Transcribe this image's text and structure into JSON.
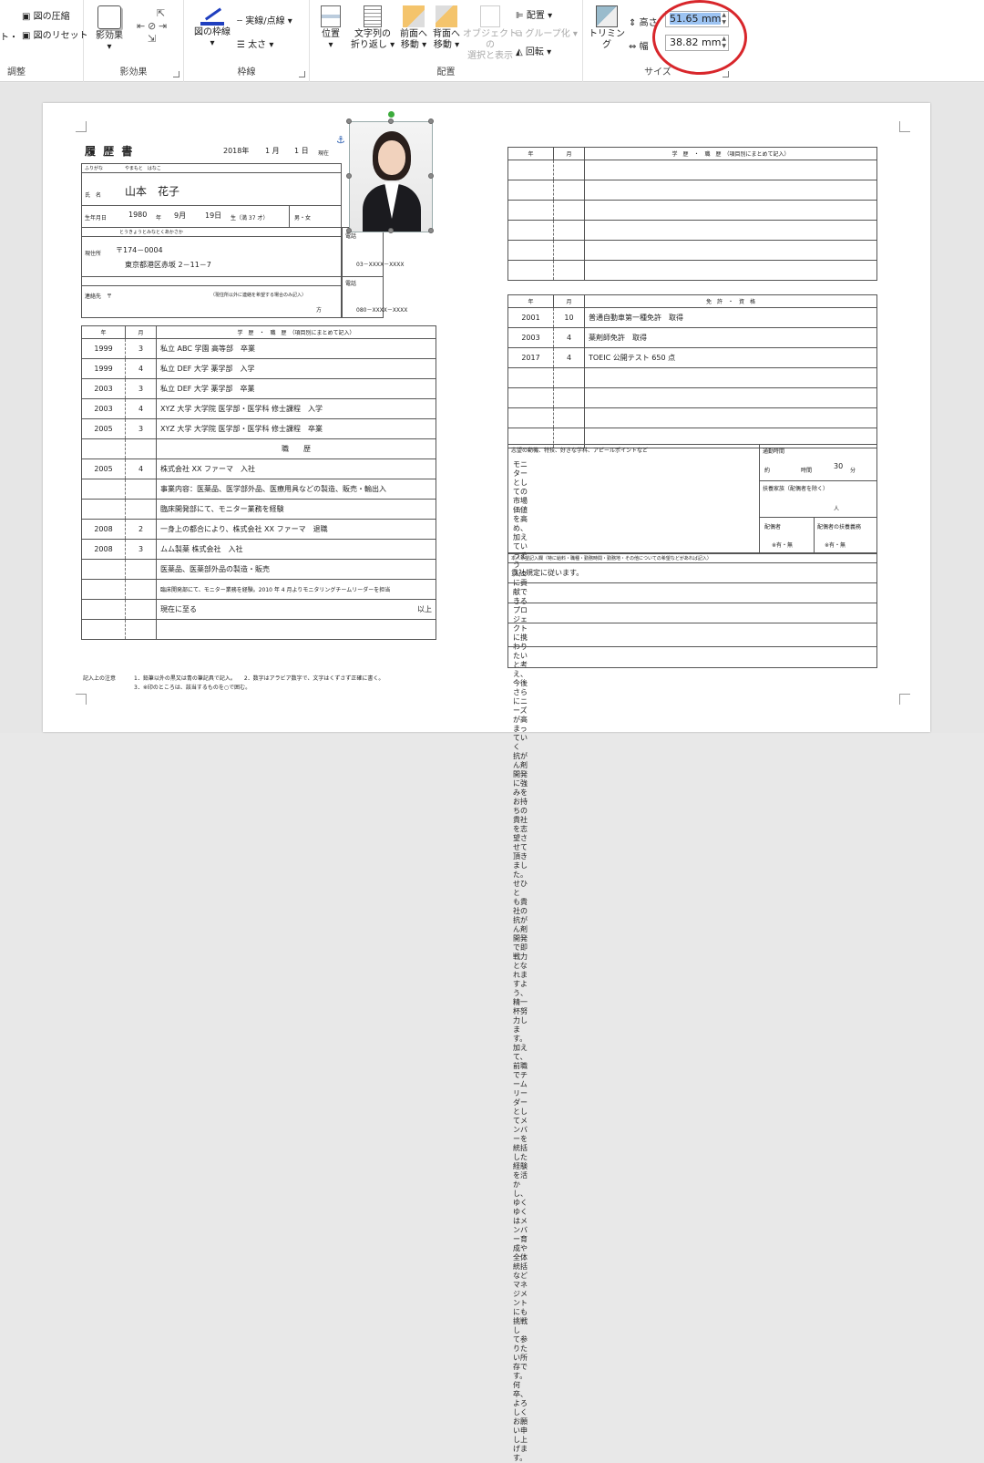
{
  "ribbon": {
    "adjust": {
      "compress": "図の圧縮",
      "reset": "図のリセット",
      "left_fragment": "ト・",
      "label": "調整"
    },
    "effects": {
      "button": "影効果",
      "label": "影効果"
    },
    "border": {
      "pic_border": "図の枠線",
      "dashes": "実線/点線",
      "weight": "太さ",
      "label": "枠線"
    },
    "arrange": {
      "position": "位置",
      "wrap": "文字列の\n折り返し",
      "forward": "前面へ\n移動",
      "backward": "背面へ\n移動",
      "selection_pane": "オブジェクトの\n選択と表示",
      "align": "配置",
      "group": "グループ化",
      "rotate": "回転",
      "label": "配置"
    },
    "size": {
      "crop": "トリミング",
      "height_label": "高さ",
      "width_label": "幅",
      "height_value": "51.65 mm",
      "width_value": "38.82 mm",
      "label": "サイズ"
    }
  },
  "resume": {
    "title": "履 歴 書",
    "date": {
      "year": "2018年",
      "month": "1 月",
      "day": "1 日",
      "as_of": "現在"
    },
    "furigana_label": "ふりがな",
    "furigana_name": "やまもと　はなこ",
    "name_label": "氏　名",
    "name": "山本　花子",
    "birth_label": "生年月日",
    "birth": {
      "year": "1980",
      "y": "年",
      "month": "9月",
      "day": "19日",
      "age": "生（満 37 才）",
      "gender": "男・女"
    },
    "addr_kana": "とうきょうとみなとくあかさか",
    "addr_label": "現住所",
    "zip": "〒174－0004",
    "address": "東京都港区赤坂 2－11－7",
    "phone_label": "電話",
    "phone": "03－XXXX－XXXX",
    "contact_label": "連絡先　〒",
    "contact_note": "（現住所以外に連絡を希望する場合のみ記入）",
    "contact_suffix": "方",
    "contact_phone_label": "電話",
    "contact_phone": "080－XXXX－XXXX",
    "hist_head": {
      "year": "年",
      "month": "月",
      "desc": "学　歴　・　職　歴　（項目別にまとめて記入）"
    },
    "history": [
      {
        "y": "1999",
        "m": "3",
        "t": "私立 ABC 学園 高等部　卒業"
      },
      {
        "y": "1999",
        "m": "4",
        "t": "私立 DEF 大学 薬学部　入学"
      },
      {
        "y": "2003",
        "m": "3",
        "t": "私立 DEF 大学 薬学部　卒業"
      },
      {
        "y": "2003",
        "m": "4",
        "t": "XYZ 大学 大学院 医学部・医学科 修士課程　入学"
      },
      {
        "y": "2005",
        "m": "3",
        "t": "XYZ 大学 大学院 医学部・医学科 修士課程　卒業"
      },
      {
        "y": "",
        "m": "",
        "t": "職　　歴"
      },
      {
        "y": "2005",
        "m": "4",
        "t": "株式会社 XX ファーマ　入社"
      },
      {
        "y": "",
        "m": "",
        "t": "事業内容：医薬品、医学部外品、医療用具などの製造、販売・輸出入"
      },
      {
        "y": "",
        "m": "",
        "t": "臨床開発部にて、モニター業務を経験"
      },
      {
        "y": "2008",
        "m": "2",
        "t": "一身上の都合により、株式会社 XX ファーマ　退職"
      },
      {
        "y": "2008",
        "m": "3",
        "t": "ムム製薬 株式会社　入社"
      },
      {
        "y": "",
        "m": "",
        "t": "医薬品、医薬部外品の製造・販売"
      },
      {
        "y": "",
        "m": "",
        "t": "臨床開発部にて、モニター業務を経験。2010 年 4 月よりモニタリングチームリーダーを担当"
      },
      {
        "y": "",
        "m": "",
        "t": "現在に至る",
        "r": "以上"
      },
      {
        "y": "",
        "m": "",
        "t": ""
      }
    ],
    "notes_label": "記入上の注意",
    "notes": [
      "1．鉛筆以外の黒又は青の筆記具で記入。　　2．数字はアラビア数字で、文字はくずさず正確に書く。",
      "3．※印のところは、該当するものを○で囲む。"
    ],
    "right_hist_head": {
      "year": "年",
      "month": "月",
      "desc": "学　歴　・　職　歴　（項目別にまとめて記入）"
    },
    "lic_head": {
      "year": "年",
      "month": "月",
      "desc": "免　許　・　資　格"
    },
    "licenses": [
      {
        "y": "2001",
        "m": "10",
        "t": "普通自動車第一種免許　取得"
      },
      {
        "y": "2003",
        "m": "4",
        "t": "薬剤師免許　取得"
      },
      {
        "y": "2017",
        "m": "4",
        "t": "TOEIC 公開テスト 650 点"
      }
    ],
    "motive_label": "志望の動機、特技、好きな学科、アピールポイントなど",
    "motive": [
      "モニターとしての市場価値を高め、加えていっそう人々に貢献できる",
      "プロジェクトに携わりたいと考え、今後さらにニーズが高まっていく",
      "抗がん剤開発に強みをお持ちの貴社を志望させて頂きました。せひと",
      "も貴社の抗がん剤開発で即戦力となれますよう、精一杯努力します。",
      "加えて、前職でチームリーダーとしてメンバーを統括した経験を活か",
      "し、ゆくゆくはメンバー育成や全体統括などマネジメントにも挑戦し",
      "て参りたい所存です。",
      "何卒、よろしくお願い申し上げます。"
    ],
    "commute_label": "通勤時間",
    "commute": {
      "approx": "約",
      "hours": "時間",
      "minutes": "30",
      "min_unit": "分"
    },
    "dependents_label": "扶養家族（配偶者を除く）",
    "dependents_unit": "人",
    "spouse_label": "配偶者",
    "spouse_value": "※有・無",
    "spouse_duty_label": "配偶者の扶養義務",
    "spouse_duty_value": "※有・無",
    "request_label": "本人希望記入欄（特に給料・職種・勤務時間・勤務地・その他についての希望などがあれば記入）",
    "request": "貴社規定に従います。"
  },
  "colors": {
    "accent": "#d8262b",
    "selection": "#9cc3f2"
  }
}
